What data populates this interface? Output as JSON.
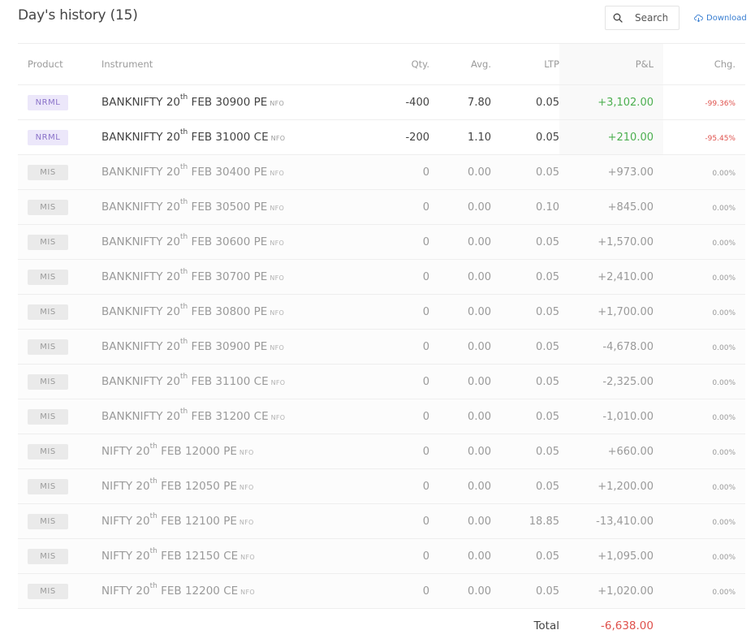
{
  "title": "Day's history (15)",
  "search": {
    "placeholder": "Search"
  },
  "download_label": "Download",
  "columns": {
    "product": "Product",
    "instrument": "Instrument",
    "qty": "Qty.",
    "avg": "Avg.",
    "ltp": "LTP",
    "pnl": "P&L",
    "chg": "Chg."
  },
  "rows": [
    {
      "product": "NRML",
      "name": "BANKNIFTY 20",
      "sup": "th",
      "rest": " FEB 30900 PE",
      "exchange": "NFO",
      "qty": "-400",
      "avg": "7.80",
      "ltp": "0.05",
      "pnl": "+3,102.00",
      "chg": "-99.36%"
    },
    {
      "product": "NRML",
      "name": "BANKNIFTY 20",
      "sup": "th",
      "rest": " FEB 31000 CE",
      "exchange": "NFO",
      "qty": "-200",
      "avg": "1.10",
      "ltp": "0.05",
      "pnl": "+210.00",
      "chg": "-95.45%"
    },
    {
      "product": "MIS",
      "name": "BANKNIFTY 20",
      "sup": "th",
      "rest": " FEB 30400 PE",
      "exchange": "NFO",
      "qty": "0",
      "avg": "0.00",
      "ltp": "0.05",
      "pnl": "+973.00",
      "chg": "0.00%"
    },
    {
      "product": "MIS",
      "name": "BANKNIFTY 20",
      "sup": "th",
      "rest": " FEB 30500 PE",
      "exchange": "NFO",
      "qty": "0",
      "avg": "0.00",
      "ltp": "0.10",
      "pnl": "+845.00",
      "chg": "0.00%"
    },
    {
      "product": "MIS",
      "name": "BANKNIFTY 20",
      "sup": "th",
      "rest": " FEB 30600 PE",
      "exchange": "NFO",
      "qty": "0",
      "avg": "0.00",
      "ltp": "0.05",
      "pnl": "+1,570.00",
      "chg": "0.00%"
    },
    {
      "product": "MIS",
      "name": "BANKNIFTY 20",
      "sup": "th",
      "rest": " FEB 30700 PE",
      "exchange": "NFO",
      "qty": "0",
      "avg": "0.00",
      "ltp": "0.05",
      "pnl": "+2,410.00",
      "chg": "0.00%"
    },
    {
      "product": "MIS",
      "name": "BANKNIFTY 20",
      "sup": "th",
      "rest": " FEB 30800 PE",
      "exchange": "NFO",
      "qty": "0",
      "avg": "0.00",
      "ltp": "0.05",
      "pnl": "+1,700.00",
      "chg": "0.00%"
    },
    {
      "product": "MIS",
      "name": "BANKNIFTY 20",
      "sup": "th",
      "rest": " FEB 30900 PE",
      "exchange": "NFO",
      "qty": "0",
      "avg": "0.00",
      "ltp": "0.05",
      "pnl": "-4,678.00",
      "chg": "0.00%"
    },
    {
      "product": "MIS",
      "name": "BANKNIFTY 20",
      "sup": "th",
      "rest": " FEB 31100 CE",
      "exchange": "NFO",
      "qty": "0",
      "avg": "0.00",
      "ltp": "0.05",
      "pnl": "-2,325.00",
      "chg": "0.00%"
    },
    {
      "product": "MIS",
      "name": "BANKNIFTY 20",
      "sup": "th",
      "rest": " FEB 31200 CE",
      "exchange": "NFO",
      "qty": "0",
      "avg": "0.00",
      "ltp": "0.05",
      "pnl": "-1,010.00",
      "chg": "0.00%"
    },
    {
      "product": "MIS",
      "name": "NIFTY 20",
      "sup": "th",
      "rest": " FEB 12000 PE",
      "exchange": "NFO",
      "qty": "0",
      "avg": "0.00",
      "ltp": "0.05",
      "pnl": "+660.00",
      "chg": "0.00%"
    },
    {
      "product": "MIS",
      "name": "NIFTY 20",
      "sup": "th",
      "rest": " FEB 12050 PE",
      "exchange": "NFO",
      "qty": "0",
      "avg": "0.00",
      "ltp": "0.05",
      "pnl": "+1,200.00",
      "chg": "0.00%"
    },
    {
      "product": "MIS",
      "name": "NIFTY 20",
      "sup": "th",
      "rest": " FEB 12100 PE",
      "exchange": "NFO",
      "qty": "0",
      "avg": "0.00",
      "ltp": "18.85",
      "pnl": "-13,410.00",
      "chg": "0.00%"
    },
    {
      "product": "MIS",
      "name": "NIFTY 20",
      "sup": "th",
      "rest": " FEB 12150 CE",
      "exchange": "NFO",
      "qty": "0",
      "avg": "0.00",
      "ltp": "0.05",
      "pnl": "+1,095.00",
      "chg": "0.00%"
    },
    {
      "product": "MIS",
      "name": "NIFTY 20",
      "sup": "th",
      "rest": " FEB 12200 CE",
      "exchange": "NFO",
      "qty": "0",
      "avg": "0.00",
      "ltp": "0.05",
      "pnl": "+1,020.00",
      "chg": "0.00%"
    }
  ],
  "total": {
    "label": "Total",
    "value": "-6,638.00"
  },
  "colors": {
    "accent": "#387ed1",
    "profit": "#4caf50",
    "loss": "#df514c",
    "nrml_badge_bg": "#ece7fa",
    "nrml_badge_text": "#8a72c9",
    "mis_badge_bg": "#eaeaea"
  }
}
